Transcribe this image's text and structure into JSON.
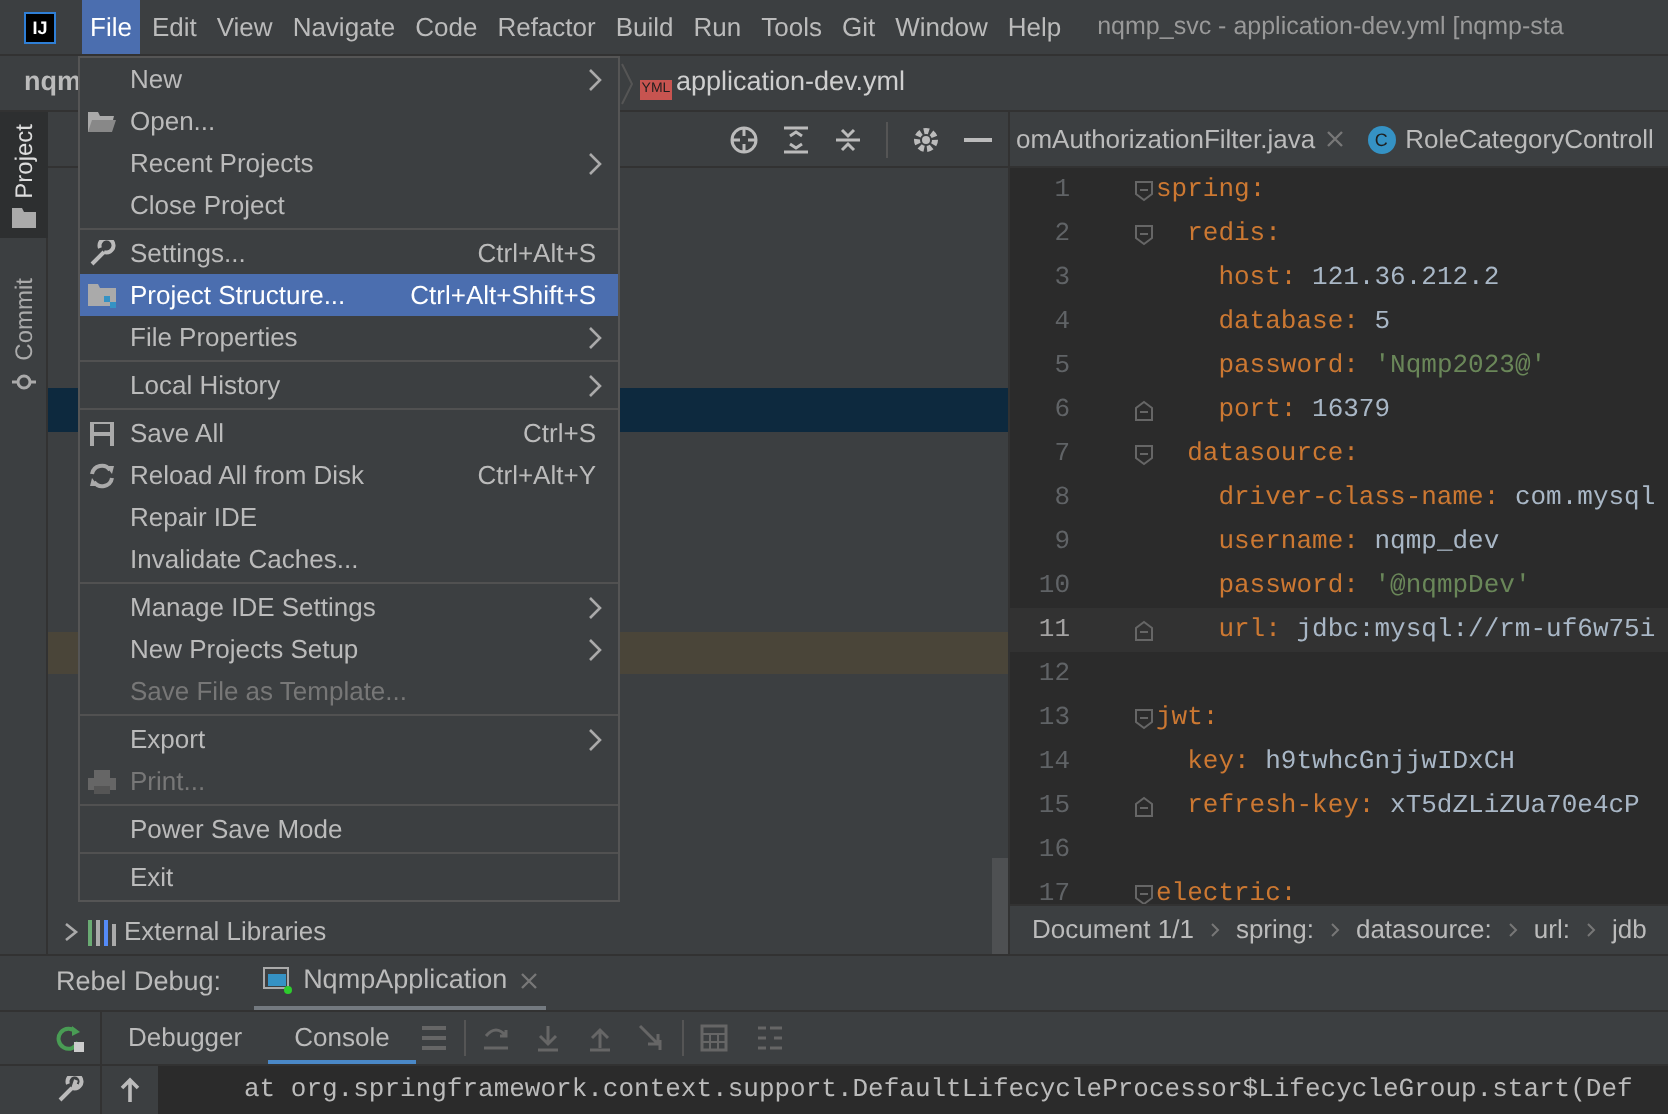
{
  "menu_bar": {
    "logo": "IJ",
    "items": [
      {
        "label": "File",
        "selected": true
      },
      {
        "label": "Edit",
        "selected": false
      },
      {
        "label": "View",
        "selected": false
      },
      {
        "label": "Navigate",
        "selected": false
      },
      {
        "label": "Code",
        "selected": false
      },
      {
        "label": "Refactor",
        "selected": false
      },
      {
        "label": "Build",
        "selected": false
      },
      {
        "label": "Run",
        "selected": false
      },
      {
        "label": "Tools",
        "selected": false
      },
      {
        "label": "Git",
        "selected": false
      },
      {
        "label": "Window",
        "selected": false
      },
      {
        "label": "Help",
        "selected": false
      }
    ],
    "title": "nqmp_svc - application-dev.yml [nqmp-sta"
  },
  "nav_bar": {
    "project": "nqm",
    "file_badge": "YML",
    "file": "application-dev.yml"
  },
  "tool_strip": [
    {
      "label": "Project",
      "selected": true
    },
    {
      "label": "Commit",
      "selected": false
    }
  ],
  "project_panel": {
    "tree_items": [
      {
        "label": "External Libraries",
        "expanded": false
      }
    ]
  },
  "editor": {
    "tabs": [
      {
        "label": "omAuthorizationFilter.java",
        "closable": true
      },
      {
        "label": "RoleCategoryControll",
        "badge": "C",
        "closable": false
      }
    ],
    "lines": [
      {
        "number": "1",
        "current": false,
        "fold_start": true,
        "tokens": [
          {
            "kind": "key",
            "text": "spring"
          },
          {
            "kind": "punct",
            "text": ":"
          }
        ]
      },
      {
        "number": "2",
        "current": false,
        "fold_start": true,
        "tokens": [
          {
            "kind": "key",
            "text": "  redis"
          },
          {
            "kind": "punct",
            "text": ":"
          }
        ]
      },
      {
        "number": "3",
        "current": false,
        "tokens": [
          {
            "kind": "key",
            "text": "    host"
          },
          {
            "kind": "punct",
            "text": ": "
          },
          {
            "kind": "value",
            "text": "121.36.212.2"
          }
        ]
      },
      {
        "number": "4",
        "current": false,
        "tokens": [
          {
            "kind": "key",
            "text": "    database"
          },
          {
            "kind": "punct",
            "text": ": "
          },
          {
            "kind": "value",
            "text": "5"
          }
        ]
      },
      {
        "number": "5",
        "current": false,
        "tokens": [
          {
            "kind": "key",
            "text": "    password"
          },
          {
            "kind": "punct",
            "text": ": "
          },
          {
            "kind": "string",
            "text": "'Nqmp2023@'"
          }
        ]
      },
      {
        "number": "6",
        "current": false,
        "fold_end": true,
        "tokens": [
          {
            "kind": "key",
            "text": "    port"
          },
          {
            "kind": "punct",
            "text": ": "
          },
          {
            "kind": "value",
            "text": "16379"
          }
        ]
      },
      {
        "number": "7",
        "current": false,
        "fold_start": true,
        "tokens": [
          {
            "kind": "key",
            "text": "  datasource"
          },
          {
            "kind": "punct",
            "text": ":"
          }
        ]
      },
      {
        "number": "8",
        "current": false,
        "tokens": [
          {
            "kind": "key",
            "text": "    driver-class-name"
          },
          {
            "kind": "punct",
            "text": ": "
          },
          {
            "kind": "value",
            "text": "com.mysql"
          }
        ]
      },
      {
        "number": "9",
        "current": false,
        "tokens": [
          {
            "kind": "key",
            "text": "    username"
          },
          {
            "kind": "punct",
            "text": ": "
          },
          {
            "kind": "value",
            "text": "nqmp_dev"
          }
        ]
      },
      {
        "number": "10",
        "current": false,
        "tokens": [
          {
            "kind": "key",
            "text": "    password"
          },
          {
            "kind": "punct",
            "text": ": "
          },
          {
            "kind": "string",
            "text": "'@nqmpDev'"
          }
        ]
      },
      {
        "number": "11",
        "current": true,
        "fold_end": true,
        "tokens": [
          {
            "kind": "key",
            "text": "    url"
          },
          {
            "kind": "punct",
            "text": ": "
          },
          {
            "kind": "value",
            "text": "jdbc:mysql://rm-uf6w75i"
          }
        ]
      },
      {
        "number": "12",
        "current": false
      },
      {
        "number": "13",
        "current": false,
        "fold_start": true,
        "tokens": [
          {
            "kind": "key",
            "text": "jwt"
          },
          {
            "kind": "punct",
            "text": ":"
          }
        ]
      },
      {
        "number": "14",
        "current": false,
        "tokens": [
          {
            "kind": "key",
            "text": "  key"
          },
          {
            "kind": "punct",
            "text": ": "
          },
          {
            "kind": "value",
            "text": "h9twhcGnjjwIDxCH"
          }
        ]
      },
      {
        "number": "15",
        "current": false,
        "fold_end": true,
        "tokens": [
          {
            "kind": "key",
            "text": "  refresh-key"
          },
          {
            "kind": "punct",
            "text": ": "
          },
          {
            "kind": "value",
            "text": "xT5dZLiZUa70e4cP"
          }
        ]
      },
      {
        "number": "16",
        "current": false
      },
      {
        "number": "17",
        "current": false,
        "fold_start": true,
        "tokens": [
          {
            "kind": "key",
            "text": "electric"
          },
          {
            "kind": "punct",
            "text": ":"
          }
        ]
      }
    ],
    "breadcrumbs": [
      "Document 1/1",
      "spring:",
      "datasource:",
      "url:",
      "jdb"
    ]
  },
  "bottom_panel": {
    "title": "Rebel Debug:",
    "run_tab": "NqmpApplication",
    "tabs": [
      {
        "label": "Debugger",
        "selected": false
      },
      {
        "label": "Console",
        "selected": true
      }
    ],
    "console_line": "at org.springframework.context.support.DefaultLifecycleProcessor$LifecycleGroup.start(Def"
  },
  "file_menu": {
    "items": [
      {
        "kind": "item",
        "label": "New",
        "submenu": true,
        "disabled": false,
        "selected": false
      },
      {
        "kind": "item",
        "label": "Open...",
        "submenu": false,
        "disabled": false,
        "selected": false
      },
      {
        "kind": "item",
        "label": "Recent Projects",
        "submenu": true,
        "disabled": false,
        "selected": false
      },
      {
        "kind": "item",
        "label": "Close Project",
        "submenu": false,
        "disabled": false,
        "selected": false
      },
      {
        "kind": "separator"
      },
      {
        "kind": "item",
        "label": "Settings...",
        "shortcut": "Ctrl+Alt+S",
        "submenu": false,
        "disabled": false,
        "selected": false
      },
      {
        "kind": "item",
        "label": "Project Structure...",
        "shortcut": "Ctrl+Alt+Shift+S",
        "submenu": false,
        "disabled": false,
        "selected": true,
        "annotated": true
      },
      {
        "kind": "item",
        "label": "File Properties",
        "submenu": true,
        "disabled": false,
        "selected": false
      },
      {
        "kind": "separator"
      },
      {
        "kind": "item",
        "label": "Local History",
        "submenu": true,
        "disabled": false,
        "selected": false
      },
      {
        "kind": "separator"
      },
      {
        "kind": "item",
        "label": "Save All",
        "shortcut": "Ctrl+S",
        "submenu": false,
        "disabled": false,
        "selected": false
      },
      {
        "kind": "item",
        "label": "Reload All from Disk",
        "shortcut": "Ctrl+Alt+Y",
        "submenu": false,
        "disabled": false,
        "selected": false
      },
      {
        "kind": "item",
        "label": "Repair IDE",
        "submenu": false,
        "disabled": false,
        "selected": false
      },
      {
        "kind": "item",
        "label": "Invalidate Caches...",
        "submenu": false,
        "disabled": false,
        "selected": false
      },
      {
        "kind": "separator"
      },
      {
        "kind": "item",
        "label": "Manage IDE Settings",
        "submenu": true,
        "disabled": false,
        "selected": false
      },
      {
        "kind": "item",
        "label": "New Projects Setup",
        "submenu": true,
        "disabled": false,
        "selected": false
      },
      {
        "kind": "item",
        "label": "Save File as Template...",
        "submenu": false,
        "disabled": true,
        "selected": false
      },
      {
        "kind": "separator"
      },
      {
        "kind": "item",
        "label": "Export",
        "submenu": true,
        "disabled": false,
        "selected": false
      },
      {
        "kind": "item",
        "label": "Print...",
        "submenu": false,
        "disabled": true,
        "selected": false
      },
      {
        "kind": "separator"
      },
      {
        "kind": "item",
        "label": "Power Save Mode",
        "submenu": false,
        "disabled": false,
        "selected": false
      },
      {
        "kind": "separator"
      },
      {
        "kind": "item",
        "label": "Exit",
        "submenu": false,
        "disabled": false,
        "selected": false
      }
    ]
  }
}
